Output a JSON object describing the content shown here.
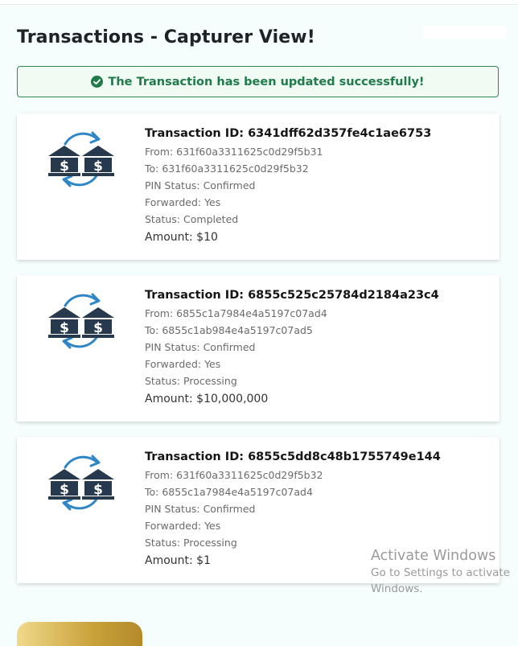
{
  "page": {
    "title": "Transactions - Capturer View!"
  },
  "alert": {
    "message": "The Transaction has been updated successfully!",
    "icon": "check-circle-icon",
    "color": "#207a4a"
  },
  "transactions": [
    {
      "id_label": "Transaction ID: 6341dff62d357fe4c1ae6753",
      "from": "From: 631f60a3311625c0d29f5b31",
      "to": "To: 631f60a3311625c0d29f5b32",
      "pin_status": "PIN Status: Confirmed",
      "forwarded": "Forwarded: Yes",
      "status": "Status: Completed",
      "amount": "Amount: $10",
      "icon": "bank-transfer-icon"
    },
    {
      "id_label": "Transaction ID: 6855c525c25784d2184a23c4",
      "from": "From: 6855c1a7984e4a5197c07ad4",
      "to": "To: 6855c1ab984e4a5197c07ad5",
      "pin_status": "PIN Status: Confirmed",
      "forwarded": "Forwarded: Yes",
      "status": "Status: Processing",
      "amount": "Amount: $10,000,000",
      "icon": "bank-transfer-icon"
    },
    {
      "id_label": "Transaction ID: 6855c5dd8c48b1755749e144",
      "from": "From: 631f60a3311625c0d29f5b32",
      "to": "To: 6855c1a7984e4a5197c07ad4",
      "pin_status": "PIN Status: Confirmed",
      "forwarded": "Forwarded: Yes",
      "status": "Status: Processing",
      "amount": "Amount: $1",
      "icon": "bank-transfer-icon"
    }
  ],
  "watermark": {
    "title": "Activate Windows",
    "line1": "Go to Settings to activate",
    "line2": "Windows."
  },
  "colors": {
    "background": "#f5fdfd",
    "icon_dark": "#27394d",
    "icon_arrow": "#2f86c6",
    "button_gold": "#c9a23a"
  }
}
